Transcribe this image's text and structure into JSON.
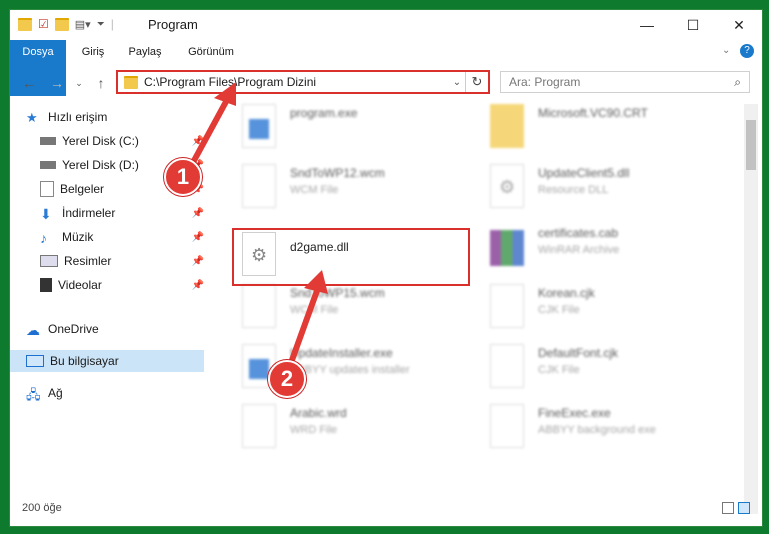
{
  "window": {
    "title": "Program",
    "minimize": "—",
    "maximize": "☐",
    "close": "✕"
  },
  "ribbon": {
    "tabs": [
      "Dosya",
      "Giriş",
      "Paylaş",
      "Görünüm"
    ]
  },
  "address": {
    "path": "C:\\Program Files\\Program Dizini",
    "search_placeholder": "Ara: Program"
  },
  "sidebar": {
    "items": [
      {
        "label": "Hızlı erişim",
        "icon": "star-icon"
      },
      {
        "label": "Yerel Disk (C:)",
        "icon": "drive-icon"
      },
      {
        "label": "Yerel Disk (D:)",
        "icon": "drive-icon"
      },
      {
        "label": "Belgeler",
        "icon": "documents-icon"
      },
      {
        "label": "İndirmeler",
        "icon": "download-icon"
      },
      {
        "label": "Müzik",
        "icon": "music-icon"
      },
      {
        "label": "Resimler",
        "icon": "pictures-icon"
      },
      {
        "label": "Videolar",
        "icon": "video-icon"
      },
      {
        "label": "OneDrive",
        "icon": "cloud-icon"
      },
      {
        "label": "Bu bilgisayar",
        "icon": "computer-icon"
      },
      {
        "label": "Ağ",
        "icon": "network-icon"
      }
    ]
  },
  "files": [
    {
      "name": "program.exe",
      "desc": ""
    },
    {
      "name": "Microsoft.VC90.CRT",
      "desc": ""
    },
    {
      "name": "SndToWP12.wcm",
      "desc": "WCM File"
    },
    {
      "name": "UpdateClient5.dll",
      "desc": "Resource DLL"
    },
    {
      "name": "d2game.dll",
      "desc": ""
    },
    {
      "name": "certificates.cab",
      "desc": "WinRAR Archive"
    },
    {
      "name": "SndToWP15.wcm",
      "desc": "WCM File"
    },
    {
      "name": "Korean.cjk",
      "desc": "CJK File"
    },
    {
      "name": "UpdateInstaller.exe",
      "desc": "ABBYY updates installer"
    },
    {
      "name": "DefaultFont.cjk",
      "desc": "CJK File"
    },
    {
      "name": "Arabic.wrd",
      "desc": "WRD File"
    },
    {
      "name": "FineExec.exe",
      "desc": "ABBYY background exe"
    }
  ],
  "status": {
    "count": "200 öğe"
  },
  "callouts": [
    "1",
    "2"
  ],
  "colors": {
    "accent": "#1979ca",
    "highlight": "#d9302c",
    "desktop": "#0e7a2e"
  }
}
